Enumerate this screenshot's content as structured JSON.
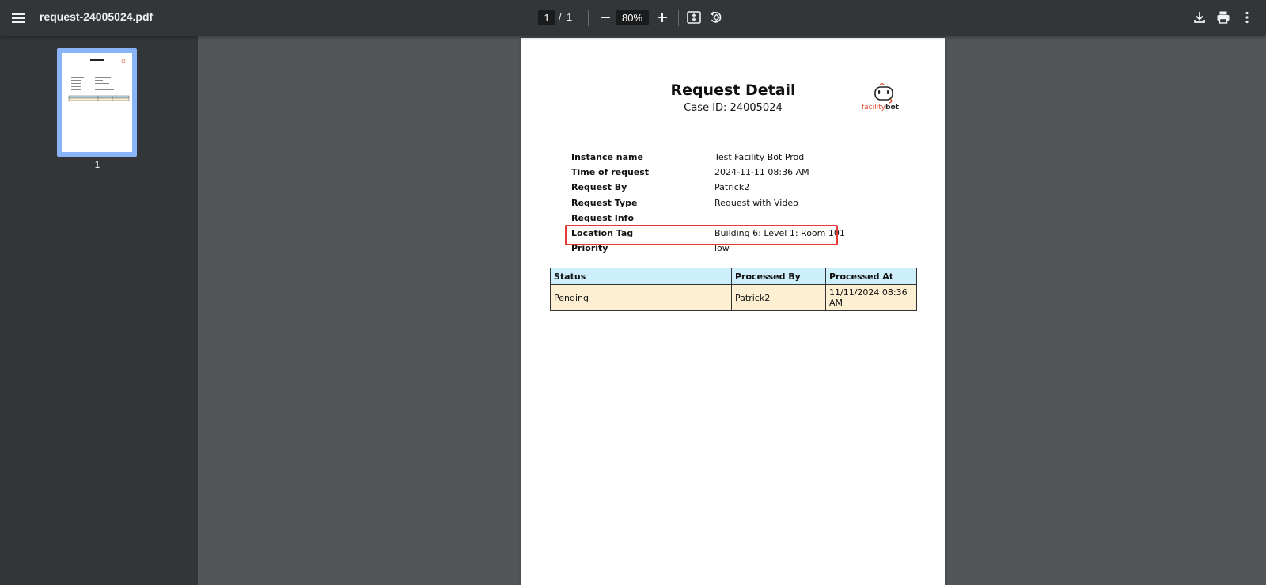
{
  "toolbar": {
    "file_name": "request-24005024.pdf",
    "current_page": "1",
    "page_separator": "/",
    "total_pages": "1",
    "zoom": "80%"
  },
  "sidebar": {
    "thumbnails": [
      {
        "page_label": "1",
        "selected": true
      }
    ]
  },
  "document": {
    "title": "Request Detail",
    "case_id": "Case ID: 24005024",
    "logo": {
      "text_part1": "facility",
      "text_part2": "bot",
      "accent_color": "#e2492c"
    },
    "fields": [
      {
        "label": "Instance name",
        "value": "Test Facility Bot Prod"
      },
      {
        "label": "Time of request",
        "value": "2024-11-11 08:36 AM"
      },
      {
        "label": "Request By",
        "value": "Patrick2"
      },
      {
        "label": "Request Type",
        "value": "Request with Video"
      },
      {
        "label": "Request Info",
        "value": ""
      },
      {
        "label": "Location Tag",
        "value": "Building 6: Level 1: Room 101",
        "highlighted": true
      },
      {
        "label": "Priority",
        "value": "low"
      }
    ],
    "table": {
      "headers": [
        "Status",
        "Processed By",
        "Processed At"
      ],
      "rows": [
        [
          "Pending",
          "Patrick2",
          "11/11/2024 08:36 AM"
        ]
      ],
      "header_bg": "#cdeefb",
      "row_bg": "#fdf0d2"
    },
    "highlight_color": "#e53935"
  }
}
